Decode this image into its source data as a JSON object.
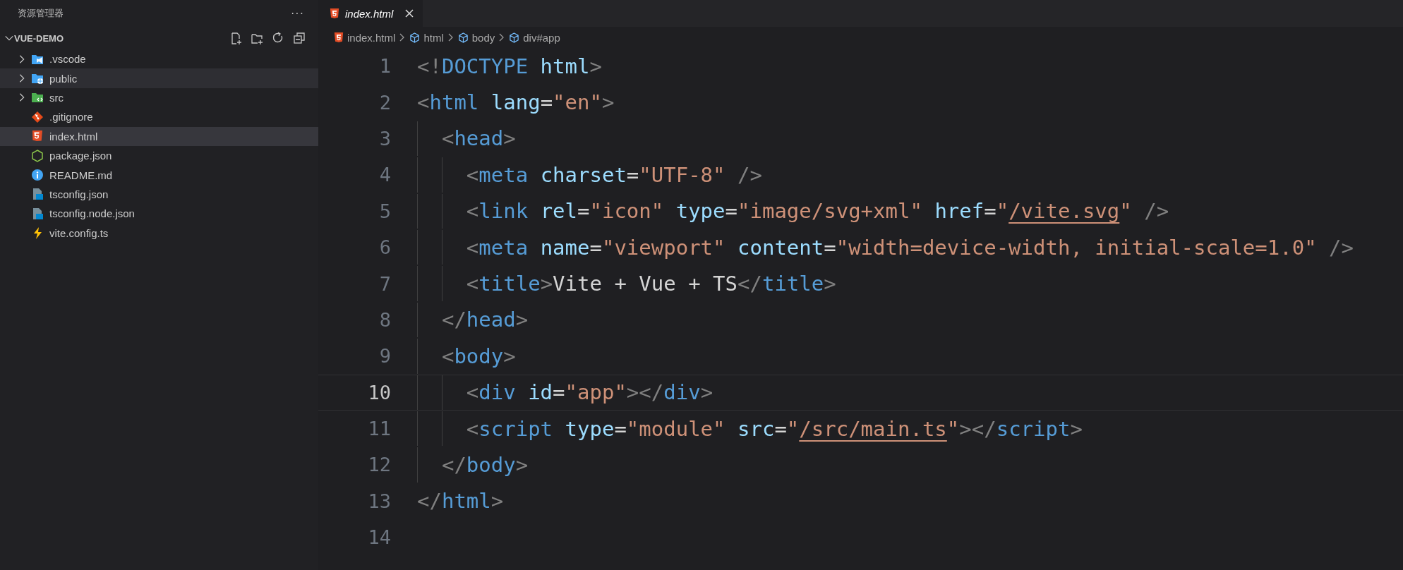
{
  "sidebar": {
    "title": "资源管理器",
    "more": "···",
    "root": {
      "name": "VUE-DEMO",
      "expanded": true,
      "children": [
        {
          "name": ".vscode",
          "kind": "vscode-folder",
          "expanded": false,
          "selected": false,
          "hovered": false
        },
        {
          "name": "public",
          "kind": "public-folder",
          "expanded": false,
          "selected": false,
          "hovered": true
        },
        {
          "name": "src",
          "kind": "src-folder",
          "expanded": false,
          "selected": false,
          "hovered": false
        },
        {
          "name": ".gitignore",
          "kind": "git",
          "selected": false,
          "hovered": false
        },
        {
          "name": "index.html",
          "kind": "html",
          "selected": true,
          "hovered": false
        },
        {
          "name": "package.json",
          "kind": "node",
          "selected": false,
          "hovered": false
        },
        {
          "name": "README.md",
          "kind": "info",
          "selected": false,
          "hovered": false
        },
        {
          "name": "tsconfig.json",
          "kind": "ts",
          "selected": false,
          "hovered": false
        },
        {
          "name": "tsconfig.node.json",
          "kind": "ts",
          "selected": false,
          "hovered": false
        },
        {
          "name": "vite.config.ts",
          "kind": "vite",
          "selected": false,
          "hovered": false
        }
      ]
    }
  },
  "tabs": [
    {
      "label": "index.html",
      "kind": "html",
      "selected": true,
      "preview": true
    }
  ],
  "breadcrumb": [
    {
      "text": "index.html",
      "kind": "html"
    },
    {
      "text": "html",
      "kind": "element"
    },
    {
      "text": "body",
      "kind": "element"
    },
    {
      "text": "div#app",
      "kind": "element"
    }
  ],
  "editor": {
    "lines": [
      {
        "number": "1",
        "current": false,
        "tokens": [
          {
            "kind": "p",
            "text": "<!"
          },
          {
            "kind": "kw",
            "text": "DOCTYPE "
          },
          {
            "kind": "attr",
            "text": "html"
          },
          {
            "kind": "p",
            "text": ">"
          }
        ]
      },
      {
        "number": "2",
        "current": false,
        "tokens": [
          {
            "kind": "p",
            "text": "<"
          },
          {
            "kind": "tag",
            "text": "html "
          },
          {
            "kind": "attr",
            "text": "lang"
          },
          {
            "kind": "t",
            "text": "="
          },
          {
            "kind": "str",
            "text": "\"en\""
          },
          {
            "kind": "p",
            "text": ">"
          }
        ]
      },
      {
        "number": "3",
        "current": false,
        "tokens": [
          {
            "kind": "p",
            "text": "  <"
          },
          {
            "kind": "tag",
            "text": "head"
          },
          {
            "kind": "p",
            "text": ">"
          }
        ]
      },
      {
        "number": "4",
        "current": false,
        "tokens": [
          {
            "kind": "p",
            "text": "    <"
          },
          {
            "kind": "tag",
            "text": "meta "
          },
          {
            "kind": "attr",
            "text": "charset"
          },
          {
            "kind": "t",
            "text": "="
          },
          {
            "kind": "str",
            "text": "\"UTF-8\" "
          },
          {
            "kind": "p",
            "text": "/>"
          }
        ]
      },
      {
        "number": "5",
        "current": false,
        "tokens": [
          {
            "kind": "p",
            "text": "    <"
          },
          {
            "kind": "tag",
            "text": "link "
          },
          {
            "kind": "attr",
            "text": "rel"
          },
          {
            "kind": "t",
            "text": "="
          },
          {
            "kind": "str",
            "text": "\"icon\" "
          },
          {
            "kind": "attr",
            "text": "type"
          },
          {
            "kind": "t",
            "text": "="
          },
          {
            "kind": "str",
            "text": "\"image/svg+xml\" "
          },
          {
            "kind": "attr",
            "text": "href"
          },
          {
            "kind": "t",
            "text": "="
          },
          {
            "kind": "str",
            "text": "\""
          },
          {
            "kind": "link",
            "text": "/vite.svg"
          },
          {
            "kind": "str",
            "text": "\" "
          },
          {
            "kind": "p",
            "text": "/>"
          }
        ]
      },
      {
        "number": "6",
        "current": false,
        "tokens": [
          {
            "kind": "p",
            "text": "    <"
          },
          {
            "kind": "tag",
            "text": "meta "
          },
          {
            "kind": "attr",
            "text": "name"
          },
          {
            "kind": "t",
            "text": "="
          },
          {
            "kind": "str",
            "text": "\"viewport\" "
          },
          {
            "kind": "attr",
            "text": "content"
          },
          {
            "kind": "t",
            "text": "="
          },
          {
            "kind": "str",
            "text": "\"width=device-width, initial-scale=1.0\" "
          },
          {
            "kind": "p",
            "text": "/>"
          }
        ]
      },
      {
        "number": "7",
        "current": false,
        "tokens": [
          {
            "kind": "p",
            "text": "    <"
          },
          {
            "kind": "tag",
            "text": "title"
          },
          {
            "kind": "p",
            "text": ">"
          },
          {
            "kind": "t",
            "text": "Vite + Vue + TS"
          },
          {
            "kind": "p",
            "text": "</"
          },
          {
            "kind": "tag",
            "text": "title"
          },
          {
            "kind": "p",
            "text": ">"
          }
        ]
      },
      {
        "number": "8",
        "current": false,
        "tokens": [
          {
            "kind": "p",
            "text": "  </"
          },
          {
            "kind": "tag",
            "text": "head"
          },
          {
            "kind": "p",
            "text": ">"
          }
        ]
      },
      {
        "number": "9",
        "current": false,
        "tokens": [
          {
            "kind": "p",
            "text": "  <"
          },
          {
            "kind": "tag",
            "text": "body"
          },
          {
            "kind": "p",
            "text": ">"
          }
        ]
      },
      {
        "number": "10",
        "current": true,
        "tokens": [
          {
            "kind": "p",
            "text": "    <"
          },
          {
            "kind": "tag",
            "text": "div "
          },
          {
            "kind": "attr",
            "text": "id"
          },
          {
            "kind": "t",
            "text": "="
          },
          {
            "kind": "str",
            "text": "\"app\""
          },
          {
            "kind": "p",
            "text": "></"
          },
          {
            "kind": "tag",
            "text": "div"
          },
          {
            "kind": "p",
            "text": ">"
          }
        ]
      },
      {
        "number": "11",
        "current": false,
        "tokens": [
          {
            "kind": "p",
            "text": "    <"
          },
          {
            "kind": "tag",
            "text": "script "
          },
          {
            "kind": "attr",
            "text": "type"
          },
          {
            "kind": "t",
            "text": "="
          },
          {
            "kind": "str",
            "text": "\"module\" "
          },
          {
            "kind": "attr",
            "text": "src"
          },
          {
            "kind": "t",
            "text": "="
          },
          {
            "kind": "str",
            "text": "\""
          },
          {
            "kind": "link",
            "text": "/src/main.ts"
          },
          {
            "kind": "str",
            "text": "\""
          },
          {
            "kind": "p",
            "text": "></"
          },
          {
            "kind": "tag",
            "text": "script"
          },
          {
            "kind": "p",
            "text": ">"
          }
        ]
      },
      {
        "number": "12",
        "current": false,
        "tokens": [
          {
            "kind": "p",
            "text": "  </"
          },
          {
            "kind": "tag",
            "text": "body"
          },
          {
            "kind": "p",
            "text": ">"
          }
        ]
      },
      {
        "number": "13",
        "current": false,
        "tokens": [
          {
            "kind": "p",
            "text": "</"
          },
          {
            "kind": "tag",
            "text": "html"
          },
          {
            "kind": "p",
            "text": ">"
          }
        ]
      },
      {
        "number": "14",
        "current": false
      }
    ]
  }
}
